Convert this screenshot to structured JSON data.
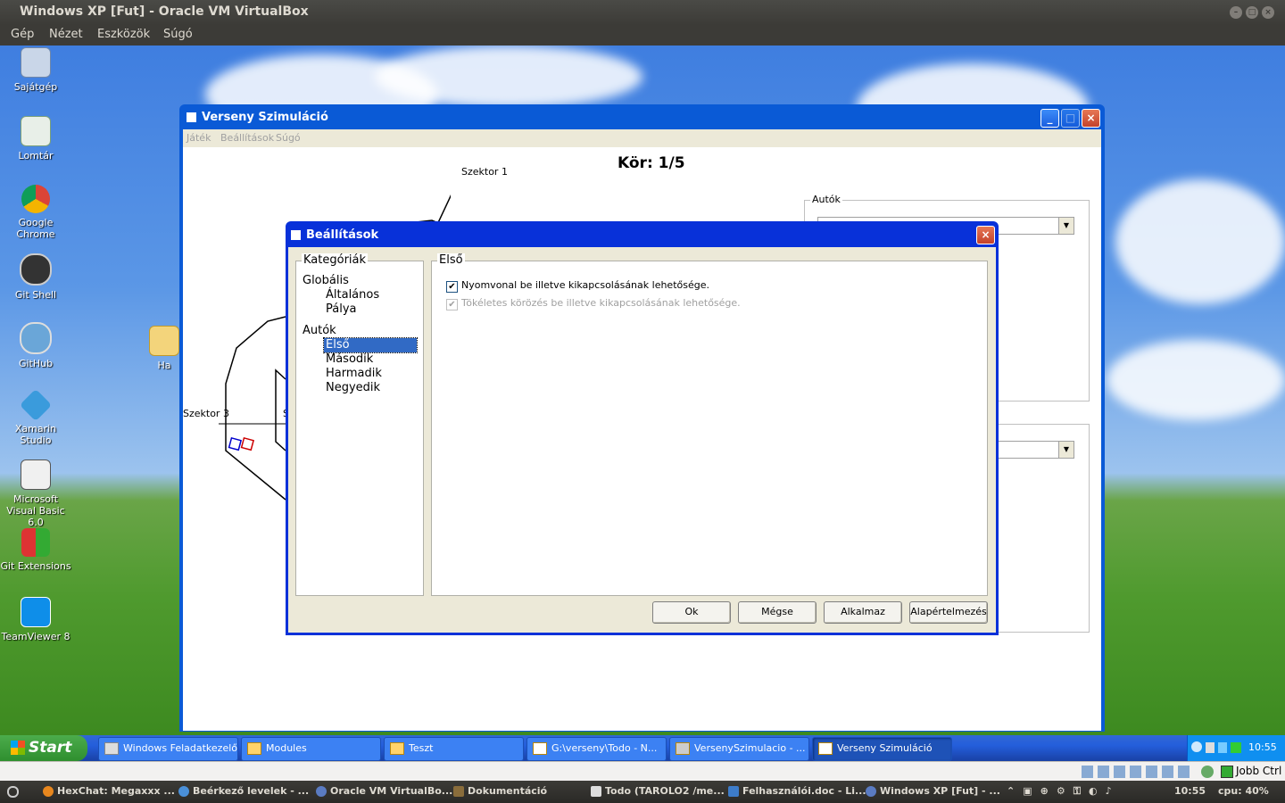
{
  "host": {
    "title": "Windows XP [Fut] - Oracle VM VirtualBox",
    "menu": [
      "Gép",
      "Nézet",
      "Eszközök",
      "Súgó"
    ]
  },
  "desktop_icons": [
    {
      "label": "Sajátgép",
      "icon": "my-computer-icon"
    },
    {
      "label": "Lomtár",
      "icon": "recycle-bin-icon"
    },
    {
      "label": "Google Chrome",
      "icon": "chrome-icon"
    },
    {
      "label": "Git Shell",
      "icon": "git-shell-icon"
    },
    {
      "label": "GitHub",
      "icon": "github-icon"
    },
    {
      "label": "Xamarin Studio",
      "icon": "xamarin-icon"
    },
    {
      "label": "Microsoft Visual Basic 6.0",
      "icon": "vb6-icon"
    },
    {
      "label": "Git Extensions",
      "icon": "git-extensions-icon"
    },
    {
      "label": "TeamViewer 8",
      "icon": "teamviewer-icon"
    },
    {
      "label": "Ha",
      "icon": "folder-icon"
    }
  ],
  "app": {
    "title": "Verseny Szimuláció",
    "menu": [
      "Játék",
      "Beállítások",
      "Súgó"
    ],
    "lap": "Kör: 1/5",
    "sector1": "Szektor 1",
    "sector3": "Szektor 3",
    "sector2_partial": "S",
    "cars_group": "Autók"
  },
  "dialog": {
    "title": "Beállítások",
    "categories_caption": "Kategóriák",
    "tree": {
      "global": "Globális",
      "global_items": [
        "Általános",
        "Pálya"
      ],
      "cars": "Autók",
      "cars_items": [
        "Első",
        "Második",
        "Harmadik",
        "Negyedik"
      ],
      "selected": "Első"
    },
    "panel_caption": "Első",
    "checkboxes": [
      {
        "label": "Nyomvonal be illetve kikapcsolásának lehetősége.",
        "checked": true,
        "enabled": true
      },
      {
        "label": "Tökéletes körözés be illetve kikapcsolásának lehetősége.",
        "checked": true,
        "enabled": false
      }
    ],
    "buttons": {
      "ok": "Ok",
      "cancel": "Mégse",
      "apply": "Alkalmaz",
      "default": "Alapértelmezés"
    }
  },
  "xp_taskbar": {
    "start": "Start",
    "tasks": [
      "Windows Feladatkezelő",
      "Modules",
      "Teszt",
      "G:\\verseny\\Todo - N...",
      "VersenySzimulacio - ...",
      "Verseny Szimuláció"
    ],
    "clock": "10:55"
  },
  "vbox_status": {
    "host_key": "Jobb Ctrl"
  },
  "ubuntu_panel": {
    "tasks": [
      "HexChat: Megaxxx ...",
      "Beérkező levelek - ...",
      "Oracle VM VirtualBo...",
      "Dokumentáció",
      "Todo (TAROLO2 /me...",
      "Felhasználói.doc - Li...",
      "Windows XP [Fut] - ..."
    ],
    "clock": "10:55",
    "cpu": "cpu: 40%"
  }
}
